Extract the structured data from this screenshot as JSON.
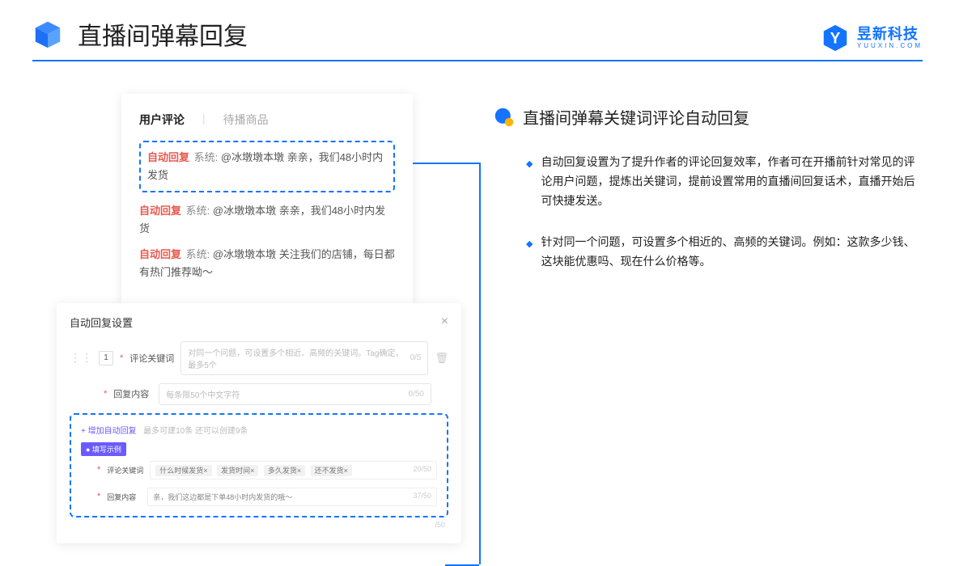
{
  "header": {
    "title": "直播间弹幕回复"
  },
  "brand": {
    "name": "昱新科技",
    "sub": "YUUXIN.COM"
  },
  "comments": {
    "tab1": "用户评论",
    "tab2": "待播商品",
    "row1_badge": "自动回复",
    "row1_sys": "系统:",
    "row1_text": "@冰墩墩本墩 亲亲，我们48小时内发货",
    "row2_badge": "自动回复",
    "row2_sys": "系统:",
    "row2_text": "@冰墩墩本墩 亲亲，我们48小时内发货",
    "row3_badge": "自动回复",
    "row3_sys": "系统:",
    "row3_text": "@冰墩墩本墩 关注我们的店铺，每日都有热门推荐呦～"
  },
  "settings": {
    "title": "自动回复设置",
    "idx": "1",
    "label_kw": "评论关键词",
    "ph_kw": "对同一个问题，可设置多个相近、高频的关键词。Tag确定，最多5个",
    "cnt_kw": "0/5",
    "label_reply": "回复内容",
    "ph_reply": "每条限50个中文字符",
    "cnt_reply": "0/50",
    "add": "+ 增加自动回复",
    "add_hint": "最多可建10条 还可以创建9条",
    "example_badge": "● 填写示例",
    "ex_kw_label": "评论关键词",
    "ex_kw_cnt": "20/50",
    "tag1": "什么时候发货×",
    "tag2": "发货时间×",
    "tag3": "多久发货×",
    "tag4": "还不发货×",
    "ex_reply_label": "回复内容",
    "ex_reply_text": "亲，我们这边都是下单48小时内发货的哦～",
    "ex_reply_cnt": "37/50",
    "outer_cnt": "/50"
  },
  "right": {
    "title": "直播间弹幕关键词评论自动回复",
    "b1": "自动回复设置为了提升作者的评论回复效率，作者可在开播前针对常见的评论用户问题，提炼出关键词，提前设置常用的直播间回复话术，直播开始后可快捷发送。",
    "b2": "针对同一个问题，可设置多个相近的、高频的关键词。例如：这款多少钱、这块能优惠吗、现在什么价格等。"
  }
}
